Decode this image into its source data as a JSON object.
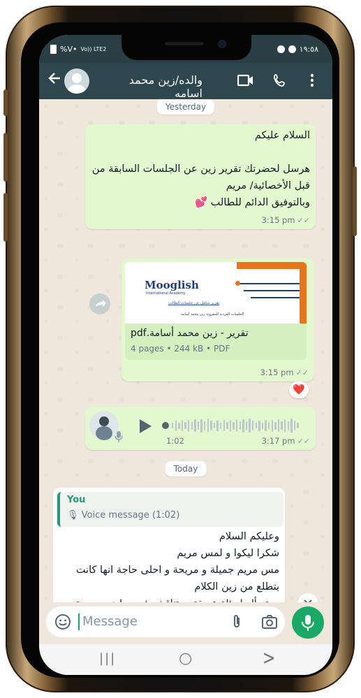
{
  "status": {
    "battery": "%V•",
    "signal": "Vo)) LTE2",
    "time": "١٩:٥٨"
  },
  "header": {
    "back_icon": "arrow-left-icon",
    "contact_name": "والده/زين محمد اسامه",
    "video_icon": "video-icon",
    "call_icon": "phone-icon",
    "menu_icon": "more-vert-icon"
  },
  "dates": {
    "yesterday": "Yesterday",
    "today": "Today"
  },
  "msg1": {
    "line1": "السلام عليكم",
    "line2": "هرسل لحضرتك تقرير زين عن الجلسات السابقة من",
    "line3": "قبل الأخصائية/ مريم",
    "line4": "وبالتوفيق الدائم للطالب",
    "emoji": "💕",
    "time": "3:15 pm"
  },
  "msg2": {
    "logo": "Mooglish",
    "logo_sub": "International Academy",
    "thumb_link": "تقرير شامل عن جلسات الطالب",
    "thumb_caption": "الجلسات الفردية للمقروية زين محمد أسامة",
    "file_name": "تقرير - زين محمد أسامة.pdf",
    "file_meta": "4 pages • 244 kB • PDF",
    "time": "3:15 pm",
    "reaction": "❤️",
    "forward_icon": "forward-icon"
  },
  "msg3": {
    "duration": "1:02",
    "time": "3:17 pm",
    "play_icon": "play-icon"
  },
  "msg4": {
    "reply_author": "You",
    "reply_preview": "Voice message (1:02)",
    "line1": "وعليكم السلام",
    "line2": "شكرا ليكوا و لمس مريم",
    "line3": "مس مريم جميلة و مريحة و احلى حاجة انها كانت",
    "line4": "بتطلع من زين الكلام",
    "line5": "و بتسأله اسئلة عميقة و بتناقشه فى مواضيع جديدة",
    "emoji": "🤍"
  },
  "composer": {
    "placeholder": "Message",
    "emoji_icon": "emoji-icon",
    "attach_icon": "paperclip-icon",
    "camera_icon": "camera-icon",
    "mic_icon": "microphone-icon",
    "scroll_down_icon": "double-chevron-down-icon"
  },
  "nav": {
    "recent": "|||",
    "home": "○",
    "back": ">"
  },
  "colors": {
    "appbar": "#2e464d",
    "outgoing": "#e4f8cf",
    "accent": "#1aa867",
    "reply_author": "#1f9a74"
  }
}
